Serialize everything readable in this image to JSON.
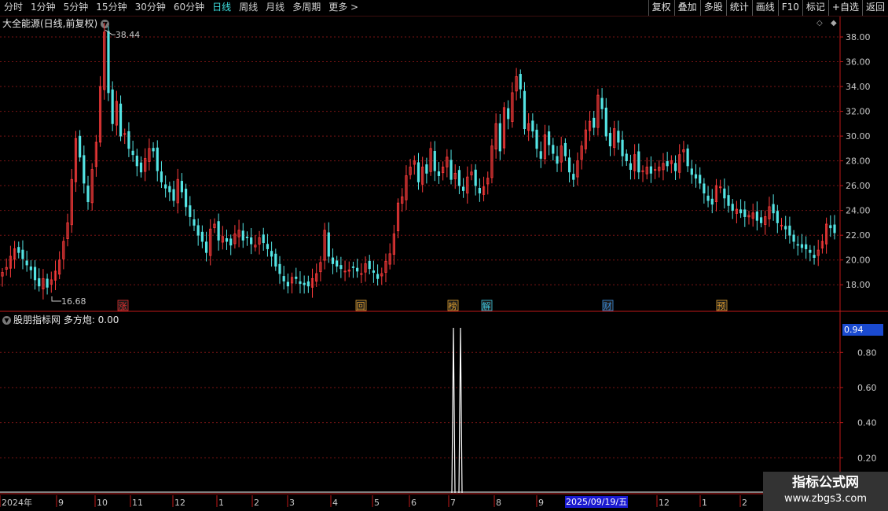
{
  "toolbar": {
    "tabs": [
      "分时",
      "1分钟",
      "5分钟",
      "15分钟",
      "30分钟",
      "60分钟",
      "日线",
      "周线",
      "月线",
      "多周期",
      "更多 >"
    ],
    "active_tab": "日线",
    "right_buttons": [
      "复权",
      "叠加",
      "多股",
      "统计",
      "画线",
      "F10",
      "标记",
      "+自选",
      "返回"
    ]
  },
  "main_chart": {
    "title": "大全能源(日线,前复权)",
    "high_label": "38.44",
    "low_label": "16.68",
    "price_axis": [
      "38.00",
      "36.00",
      "34.00",
      "32.00",
      "30.00",
      "28.00",
      "26.00",
      "24.00",
      "22.00",
      "20.00",
      "18.00"
    ],
    "markers": [
      {
        "text": "涨",
        "color": "#e03030"
      },
      {
        "text": "回",
        "color": "#e0a030"
      },
      {
        "text": "榜",
        "color": "#e0a030"
      },
      {
        "text": "解",
        "color": "#3ec8e0"
      },
      {
        "text": "财",
        "color": "#3e90e0"
      },
      {
        "text": "预",
        "color": "#e0a030"
      }
    ]
  },
  "indicator": {
    "title": "股朋指标网 多方炮: 0.00",
    "current_value": "0.94",
    "axis": [
      "0.80",
      "0.60",
      "0.40",
      "0.20"
    ]
  },
  "date_axis": {
    "labels": [
      "2024年",
      "9",
      "10",
      "11",
      "12",
      "1",
      "2",
      "3",
      "4",
      "5",
      "6",
      "7",
      "8",
      "9",
      "2025/09/19/五",
      "12",
      "1",
      "2"
    ],
    "cursor_date": "2025/09/19/五"
  },
  "watermark": {
    "line1": "指标公式网",
    "line2": "www.zbgs3.com"
  },
  "colors": {
    "up": "#ff3c3c",
    "down": "#54e4e4",
    "grid": "#7a1414",
    "axis": "#c01818",
    "text": "#c8c8c8"
  },
  "chart_data": {
    "type": "candlestick",
    "title": "大全能源(日线,前复权)",
    "ylim": [
      16,
      39
    ],
    "annotations": {
      "high": 38.44,
      "low": 16.68
    },
    "close_path": [
      19.0,
      19.4,
      20.3,
      20.9,
      20.6,
      20.1,
      19.6,
      19.2,
      18.4,
      17.9,
      18.5,
      17.8,
      18.4,
      19.1,
      20.0,
      21.5,
      23.0,
      26.5,
      29.8,
      28.3,
      26.2,
      24.7,
      27.3,
      29.5,
      34.0,
      38.4,
      33.5,
      31.0,
      32.8,
      30.0,
      30.2,
      29.0,
      28.5,
      27.6,
      27.1,
      28.2,
      29.0,
      28.8,
      27.2,
      26.3,
      25.8,
      25.5,
      24.8,
      26.5,
      25.5,
      24.3,
      23.5,
      22.8,
      22.0,
      21.5,
      20.6,
      22.5,
      22.9,
      21.6,
      21.9,
      21.5,
      21.2,
      22.1,
      22.4,
      21.6,
      21.8,
      21.3,
      21.2,
      21.8,
      21.4,
      20.9,
      20.3,
      19.5,
      18.9,
      18.3,
      17.9,
      18.6,
      18.5,
      18.1,
      18.0,
      17.9,
      18.5,
      18.9,
      19.8,
      22.4,
      20.3,
      19.7,
      19.5,
      19.3,
      19.1,
      19.2,
      19.4,
      19.1,
      18.9,
      19.7,
      19.3,
      19.0,
      18.5,
      18.9,
      19.9,
      20.5,
      22.1,
      24.6,
      25.1,
      26.8,
      27.5,
      28.0,
      26.3,
      27.5,
      27.0,
      29.0,
      27.2,
      26.8,
      27.5,
      28.3,
      26.5,
      27.0,
      26.0,
      25.6,
      26.7,
      27.1,
      26.0,
      25.4,
      25.9,
      26.6,
      29.2,
      31.0,
      28.8,
      32.3,
      31.4,
      33.5,
      34.8,
      33.8,
      30.6,
      31.0,
      30.4,
      29.0,
      28.2,
      30.1,
      29.3,
      28.6,
      27.8,
      29.2,
      28.4,
      27.1,
      26.5,
      28.0,
      29.2,
      30.5,
      31.2,
      30.7,
      33.3,
      32.2,
      30.0,
      29.2,
      30.6,
      29.5,
      28.4,
      28.0,
      27.3,
      28.5,
      27.1,
      27.2,
      27.5,
      27.0,
      27.3,
      27.5,
      27.8,
      27.6,
      28.0,
      27.2,
      28.5,
      28.9,
      27.6,
      26.9,
      26.6,
      26.2,
      25.4,
      24.8,
      24.5,
      26.0,
      25.9,
      25.0,
      24.4,
      24.0,
      24.1,
      23.8,
      23.5,
      23.6,
      23.8,
      23.2,
      23.0,
      23.5,
      24.3,
      23.8,
      23.0,
      22.8,
      22.5,
      22.0,
      21.5,
      21.2,
      21.0,
      20.9,
      20.6,
      20.2,
      20.8,
      21.5,
      22.9,
      22.6,
      22.2
    ],
    "indicator_pulses": [
      0.94,
      0.94
    ]
  }
}
